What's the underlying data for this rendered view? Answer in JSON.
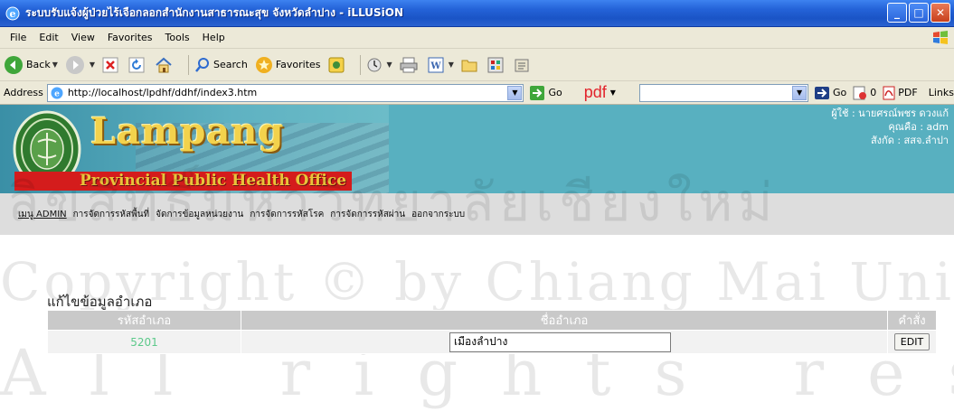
{
  "window": {
    "title": "ระบบรับแจ้งผู้ป่วยไร้เจือกลอกสำนักงานสาธารณะสุข จังหวัดลำปาง - iLLUSiON"
  },
  "menubar": {
    "items": [
      "File",
      "Edit",
      "View",
      "Favorites",
      "Tools",
      "Help"
    ]
  },
  "toolbar": {
    "back_label": "Back",
    "search_label": "Search",
    "favorites_label": "Favorites"
  },
  "addressbar": {
    "label": "Address",
    "url": "http://localhost/lpdhf/ddhf/index3.htm",
    "go_label": "Go",
    "pdf_label": "pdf",
    "go2_label": "Go",
    "count_label": "0",
    "pdf_button_label": "PDF",
    "links_label": "Links"
  },
  "banner": {
    "logo_title": "Lampang",
    "logo_subtitle": "Provincial Public Health Office",
    "user_line": "ผู้ใช้ : นายศรณ์พชร ดวงแก้",
    "role_line": "คุณคือ : adm",
    "org_line": "สังกัด : สสจ.ลำปา"
  },
  "nav": {
    "items": [
      "เมนู ADMIN",
      "การจัดการรหัสพื้นที่",
      "จัดการข้อมูลหน่วยงาน",
      "การจัดการรหัสโรค",
      "การจัดการรหัสผ่าน",
      "ออกจากระบบ"
    ]
  },
  "page": {
    "section_title": "แก้ไขข้อมูลอำเภอ",
    "table": {
      "headers": [
        "รหัสอำเภอ",
        "ชื่ออำเภอ",
        "คำสั่ง"
      ],
      "row": {
        "code": "5201",
        "name_value": "เมืองลำปาง",
        "edit_label": "EDIT"
      }
    }
  },
  "watermark": {
    "line1": "ลิขสิทธิ์มหาวิทยาลัยเชียงใหม่",
    "line2": "Copyright © by Chiang Mai University",
    "line3": "All rights reserved"
  },
  "colors": {
    "titlebar": "#2463d8",
    "chrome": "#ece9d8",
    "banner": "#58b0c0",
    "nav_bg": "#dddddd",
    "table_header": "#c9c9c9",
    "code_text": "#5cc98a"
  }
}
